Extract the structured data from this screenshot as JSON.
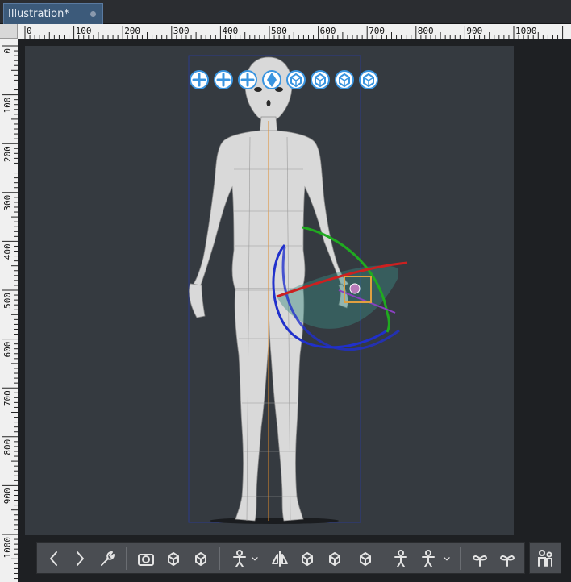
{
  "tab": {
    "title": "Illustration*"
  },
  "ruler": {
    "horizontal_labels": [
      "0",
      "100",
      "200",
      "300",
      "400",
      "500",
      "600",
      "700",
      "800",
      "900",
      "1000"
    ],
    "vertical_labels": [
      "0",
      "100",
      "200",
      "300",
      "400",
      "500",
      "600",
      "700",
      "800",
      "900",
      "1000"
    ]
  },
  "manipulator_icons": [
    "rotate-camera-icon",
    "pan-camera-icon",
    "zoom-camera-icon",
    "move-plane-icon",
    "rotate-model-icon",
    "rotate-model-y-icon",
    "move-model-icon",
    "reset-model-icon"
  ],
  "toolbar_icons": [
    "previous-icon",
    "next-icon",
    "settings-wrench-icon",
    "camera-icon",
    "fit-view-icon",
    "ground-icon",
    "pose-icon",
    "dropdown-icon",
    "flip-icon",
    "pose-reset-icon",
    "save-model-icon",
    "reset-rotation-icon",
    "body-shape-icon",
    "body-type-icon",
    "dropdown-icon",
    "lock-joint-icon",
    "unlock-joint-icon",
    "figure-scale-icon"
  ],
  "colors": {
    "canvas_bg": "#353a40",
    "body": "#d9d9d9",
    "bbox": "#2a3a8a",
    "center_line": "#e08a2a",
    "ring_x": "#cc2020",
    "ring_y": "#20aa20",
    "ring_z": "#2030cc",
    "handle": "#e0a040",
    "icon": "#3a95e0"
  }
}
